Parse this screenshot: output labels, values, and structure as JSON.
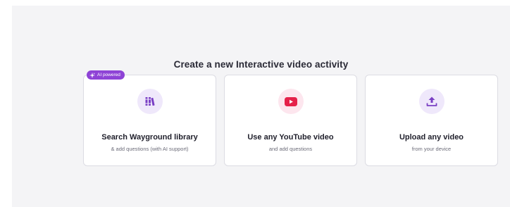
{
  "heading": "Create a new Interactive video activity",
  "badge": {
    "label": "AI powered",
    "icon": "sparkle-icon",
    "color": "#8e43d6"
  },
  "cards": [
    {
      "title": "Search Wayground library",
      "subtitle": "& add questions (with AI support)",
      "icon": "library-books-icon",
      "accent": "#7a3fc4"
    },
    {
      "title": "Use any YouTube video",
      "subtitle": "and add questions",
      "icon": "youtube-play-icon",
      "accent": "#e5214a"
    },
    {
      "title": "Upload any video",
      "subtitle": "from your device",
      "icon": "upload-icon",
      "accent": "#7a3fc4"
    }
  ]
}
